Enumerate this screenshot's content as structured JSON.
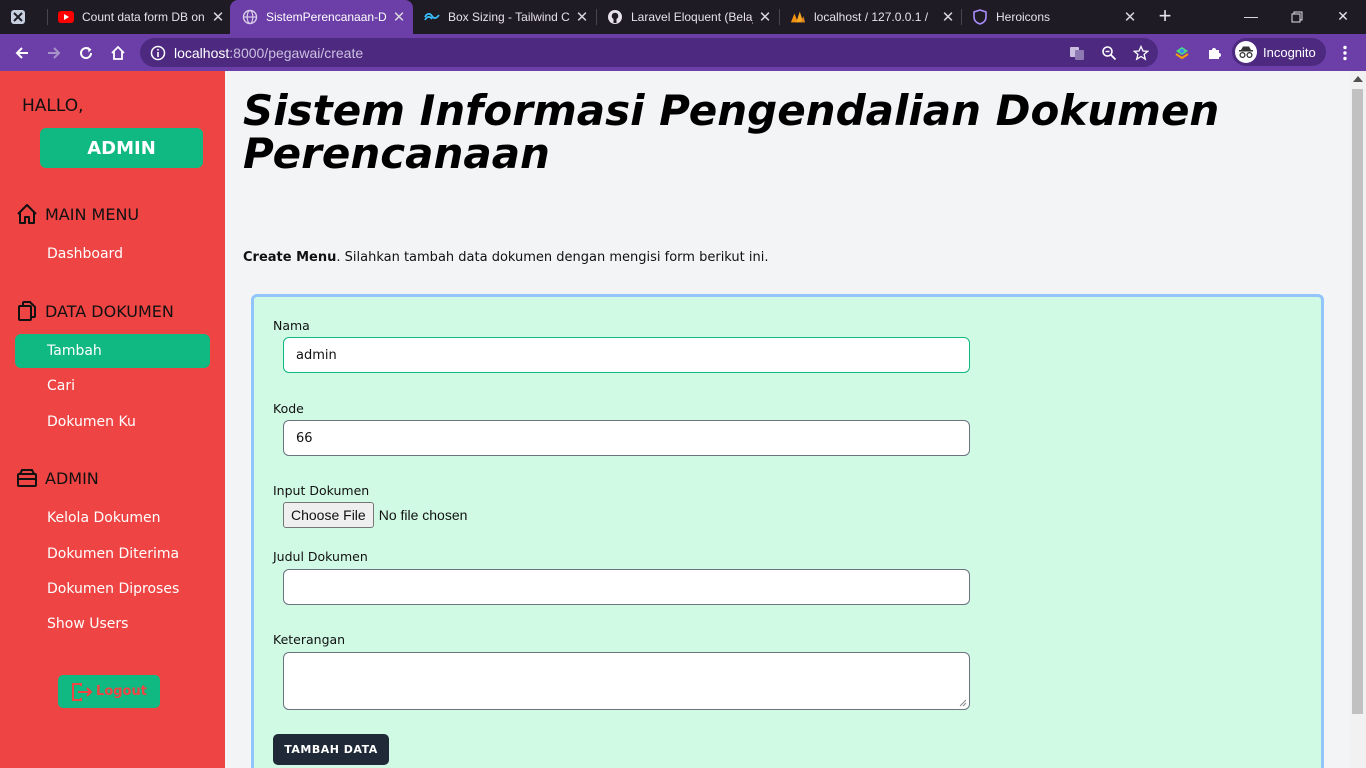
{
  "browser": {
    "tabs": [
      {
        "title": "",
        "icon": "tab-app-icon"
      },
      {
        "title": "Count data form DB on",
        "icon": "youtube-icon"
      },
      {
        "title": "SistemPerencanaan-Di",
        "icon": "globe-icon",
        "active": true
      },
      {
        "title": "Box Sizing - Tailwind C",
        "icon": "tailwind-icon"
      },
      {
        "title": "Laravel Eloquent (Belaj",
        "icon": "github-icon"
      },
      {
        "title": "localhost / 127.0.0.1 /",
        "icon": "phpmyadmin-icon"
      },
      {
        "title": "Heroicons",
        "icon": "heroicons-icon"
      }
    ],
    "url_host": "localhost",
    "url_path": ":8000/pegawai/create",
    "profile_label": "Incognito",
    "accent_color": "#6b3ea8"
  },
  "sidebar": {
    "greeting": "HALLO,",
    "user_badge": "ADMIN",
    "sections": {
      "main_menu": {
        "label": "MAIN MENU",
        "items": [
          "Dashboard"
        ]
      },
      "data_dokumen": {
        "label": "DATA DOKUMEN",
        "items": [
          "Tambah",
          "Cari",
          "Dokumen Ku"
        ]
      },
      "admin": {
        "label": "ADMIN",
        "items": [
          "Kelola Dokumen",
          "Dokumen Diterima",
          "Dokumen Diproses",
          "Show Users"
        ]
      }
    },
    "logout_label": "Logout",
    "bg_color": "#ef4444",
    "accent_color": "#10b981"
  },
  "main": {
    "title": "Sistem Informasi Pengendalian Dokumen Perencanaan",
    "intro_bold": "Create Menu",
    "intro_text": ". Silahkan tambah data dokumen dengan mengisi form berikut ini.",
    "form": {
      "nama_label": "Nama",
      "nama_value": "admin",
      "kode_label": "Kode",
      "kode_value": "66",
      "file_label": "Input Dokumen",
      "file_button": "Choose File",
      "file_status": "No file chosen",
      "judul_label": "Judul Dokumen",
      "judul_value": "",
      "keterangan_label": "Keterangan",
      "keterangan_value": "",
      "submit_label": "TAMBAH DATA"
    }
  }
}
